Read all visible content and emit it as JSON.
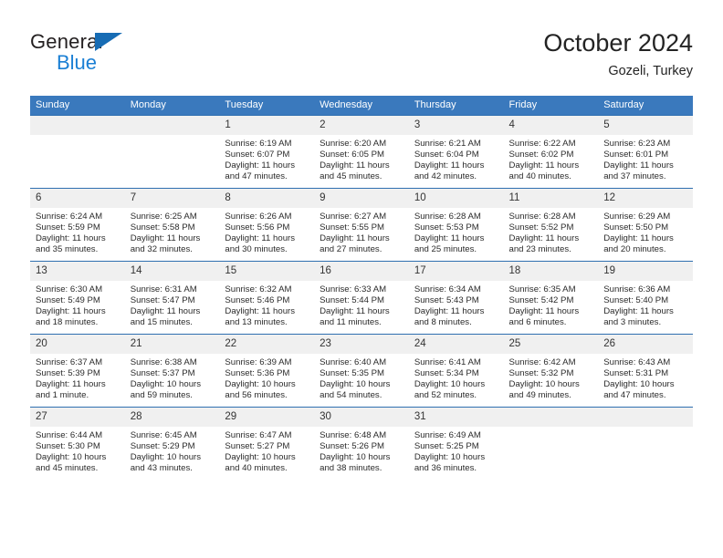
{
  "brand": {
    "name_top": "General",
    "name_bottom": "Blue",
    "accent_color": "#1a7fd4"
  },
  "header": {
    "month_title": "October 2024",
    "location": "Gozeli, Turkey"
  },
  "theme": {
    "header_bar_color": "#3a79bd",
    "row_divider_color": "#2f6fb0",
    "daynum_background": "#f0f0f0"
  },
  "weekday_headers": [
    "Sunday",
    "Monday",
    "Tuesday",
    "Wednesday",
    "Thursday",
    "Friday",
    "Saturday"
  ],
  "labels": {
    "sunrise_prefix": "Sunrise:",
    "sunset_prefix": "Sunset:",
    "daylight_prefix": "Daylight:"
  },
  "weeks": [
    [
      {
        "day": "",
        "empty": true,
        "sunrise": "",
        "sunset": "",
        "daylight": ""
      },
      {
        "day": "",
        "empty": true,
        "sunrise": "",
        "sunset": "",
        "daylight": ""
      },
      {
        "day": "1",
        "empty": false,
        "sunrise": "Sunrise: 6:19 AM",
        "sunset": "Sunset: 6:07 PM",
        "daylight": "Daylight: 11 hours and 47 minutes."
      },
      {
        "day": "2",
        "empty": false,
        "sunrise": "Sunrise: 6:20 AM",
        "sunset": "Sunset: 6:05 PM",
        "daylight": "Daylight: 11 hours and 45 minutes."
      },
      {
        "day": "3",
        "empty": false,
        "sunrise": "Sunrise: 6:21 AM",
        "sunset": "Sunset: 6:04 PM",
        "daylight": "Daylight: 11 hours and 42 minutes."
      },
      {
        "day": "4",
        "empty": false,
        "sunrise": "Sunrise: 6:22 AM",
        "sunset": "Sunset: 6:02 PM",
        "daylight": "Daylight: 11 hours and 40 minutes."
      },
      {
        "day": "5",
        "empty": false,
        "sunrise": "Sunrise: 6:23 AM",
        "sunset": "Sunset: 6:01 PM",
        "daylight": "Daylight: 11 hours and 37 minutes."
      }
    ],
    [
      {
        "day": "6",
        "empty": false,
        "sunrise": "Sunrise: 6:24 AM",
        "sunset": "Sunset: 5:59 PM",
        "daylight": "Daylight: 11 hours and 35 minutes."
      },
      {
        "day": "7",
        "empty": false,
        "sunrise": "Sunrise: 6:25 AM",
        "sunset": "Sunset: 5:58 PM",
        "daylight": "Daylight: 11 hours and 32 minutes."
      },
      {
        "day": "8",
        "empty": false,
        "sunrise": "Sunrise: 6:26 AM",
        "sunset": "Sunset: 5:56 PM",
        "daylight": "Daylight: 11 hours and 30 minutes."
      },
      {
        "day": "9",
        "empty": false,
        "sunrise": "Sunrise: 6:27 AM",
        "sunset": "Sunset: 5:55 PM",
        "daylight": "Daylight: 11 hours and 27 minutes."
      },
      {
        "day": "10",
        "empty": false,
        "sunrise": "Sunrise: 6:28 AM",
        "sunset": "Sunset: 5:53 PM",
        "daylight": "Daylight: 11 hours and 25 minutes."
      },
      {
        "day": "11",
        "empty": false,
        "sunrise": "Sunrise: 6:28 AM",
        "sunset": "Sunset: 5:52 PM",
        "daylight": "Daylight: 11 hours and 23 minutes."
      },
      {
        "day": "12",
        "empty": false,
        "sunrise": "Sunrise: 6:29 AM",
        "sunset": "Sunset: 5:50 PM",
        "daylight": "Daylight: 11 hours and 20 minutes."
      }
    ],
    [
      {
        "day": "13",
        "empty": false,
        "sunrise": "Sunrise: 6:30 AM",
        "sunset": "Sunset: 5:49 PM",
        "daylight": "Daylight: 11 hours and 18 minutes."
      },
      {
        "day": "14",
        "empty": false,
        "sunrise": "Sunrise: 6:31 AM",
        "sunset": "Sunset: 5:47 PM",
        "daylight": "Daylight: 11 hours and 15 minutes."
      },
      {
        "day": "15",
        "empty": false,
        "sunrise": "Sunrise: 6:32 AM",
        "sunset": "Sunset: 5:46 PM",
        "daylight": "Daylight: 11 hours and 13 minutes."
      },
      {
        "day": "16",
        "empty": false,
        "sunrise": "Sunrise: 6:33 AM",
        "sunset": "Sunset: 5:44 PM",
        "daylight": "Daylight: 11 hours and 11 minutes."
      },
      {
        "day": "17",
        "empty": false,
        "sunrise": "Sunrise: 6:34 AM",
        "sunset": "Sunset: 5:43 PM",
        "daylight": "Daylight: 11 hours and 8 minutes."
      },
      {
        "day": "18",
        "empty": false,
        "sunrise": "Sunrise: 6:35 AM",
        "sunset": "Sunset: 5:42 PM",
        "daylight": "Daylight: 11 hours and 6 minutes."
      },
      {
        "day": "19",
        "empty": false,
        "sunrise": "Sunrise: 6:36 AM",
        "sunset": "Sunset: 5:40 PM",
        "daylight": "Daylight: 11 hours and 3 minutes."
      }
    ],
    [
      {
        "day": "20",
        "empty": false,
        "sunrise": "Sunrise: 6:37 AM",
        "sunset": "Sunset: 5:39 PM",
        "daylight": "Daylight: 11 hours and 1 minute."
      },
      {
        "day": "21",
        "empty": false,
        "sunrise": "Sunrise: 6:38 AM",
        "sunset": "Sunset: 5:37 PM",
        "daylight": "Daylight: 10 hours and 59 minutes."
      },
      {
        "day": "22",
        "empty": false,
        "sunrise": "Sunrise: 6:39 AM",
        "sunset": "Sunset: 5:36 PM",
        "daylight": "Daylight: 10 hours and 56 minutes."
      },
      {
        "day": "23",
        "empty": false,
        "sunrise": "Sunrise: 6:40 AM",
        "sunset": "Sunset: 5:35 PM",
        "daylight": "Daylight: 10 hours and 54 minutes."
      },
      {
        "day": "24",
        "empty": false,
        "sunrise": "Sunrise: 6:41 AM",
        "sunset": "Sunset: 5:34 PM",
        "daylight": "Daylight: 10 hours and 52 minutes."
      },
      {
        "day": "25",
        "empty": false,
        "sunrise": "Sunrise: 6:42 AM",
        "sunset": "Sunset: 5:32 PM",
        "daylight": "Daylight: 10 hours and 49 minutes."
      },
      {
        "day": "26",
        "empty": false,
        "sunrise": "Sunrise: 6:43 AM",
        "sunset": "Sunset: 5:31 PM",
        "daylight": "Daylight: 10 hours and 47 minutes."
      }
    ],
    [
      {
        "day": "27",
        "empty": false,
        "sunrise": "Sunrise: 6:44 AM",
        "sunset": "Sunset: 5:30 PM",
        "daylight": "Daylight: 10 hours and 45 minutes."
      },
      {
        "day": "28",
        "empty": false,
        "sunrise": "Sunrise: 6:45 AM",
        "sunset": "Sunset: 5:29 PM",
        "daylight": "Daylight: 10 hours and 43 minutes."
      },
      {
        "day": "29",
        "empty": false,
        "sunrise": "Sunrise: 6:47 AM",
        "sunset": "Sunset: 5:27 PM",
        "daylight": "Daylight: 10 hours and 40 minutes."
      },
      {
        "day": "30",
        "empty": false,
        "sunrise": "Sunrise: 6:48 AM",
        "sunset": "Sunset: 5:26 PM",
        "daylight": "Daylight: 10 hours and 38 minutes."
      },
      {
        "day": "31",
        "empty": false,
        "sunrise": "Sunrise: 6:49 AM",
        "sunset": "Sunset: 5:25 PM",
        "daylight": "Daylight: 10 hours and 36 minutes."
      },
      {
        "day": "",
        "empty": true,
        "sunrise": "",
        "sunset": "",
        "daylight": ""
      },
      {
        "day": "",
        "empty": true,
        "sunrise": "",
        "sunset": "",
        "daylight": ""
      }
    ]
  ]
}
